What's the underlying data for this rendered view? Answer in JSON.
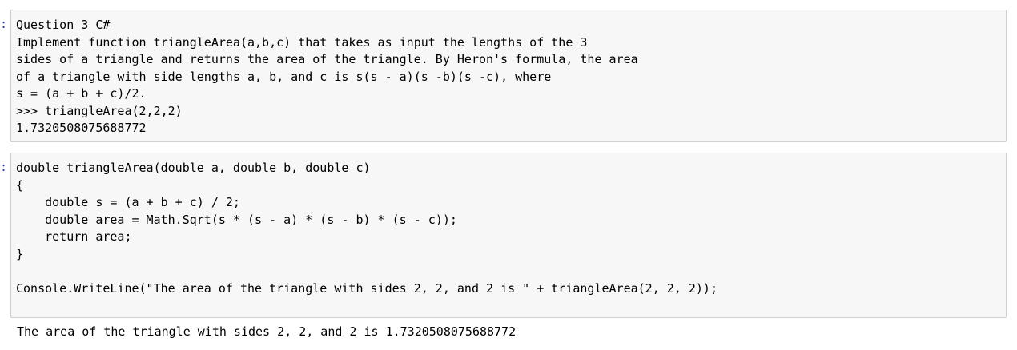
{
  "cells": [
    {
      "prompt": ":",
      "lines": [
        "Question 3 C#",
        "Implement function triangleArea(a,b,c) that takes as input the lengths of the 3",
        "sides of a triangle and returns the area of the triangle. By Heron's formula, the area",
        "of a triangle with side lengths a, b, and c is s(s - a)(s -b)(s -c), where",
        "s = (a + b + c)/2.",
        ">>> triangleArea(2,2,2)",
        "1.7320508075688772"
      ]
    },
    {
      "prompt": ":",
      "lines": [
        "double triangleArea(double a, double b, double c)",
        "{",
        "    double s = (a + b + c) / 2;",
        "    double area = Math.Sqrt(s * (s - a) * (s - b) * (s - c));",
        "    return area;",
        "}",
        "",
        "Console.WriteLine(\"The area of the triangle with sides 2, 2, and 2 is \" + triangleArea(2, 2, 2));"
      ]
    }
  ],
  "output": {
    "text": "The area of the triangle with sides 2, 2, and 2 is 1.7320508075688772"
  }
}
